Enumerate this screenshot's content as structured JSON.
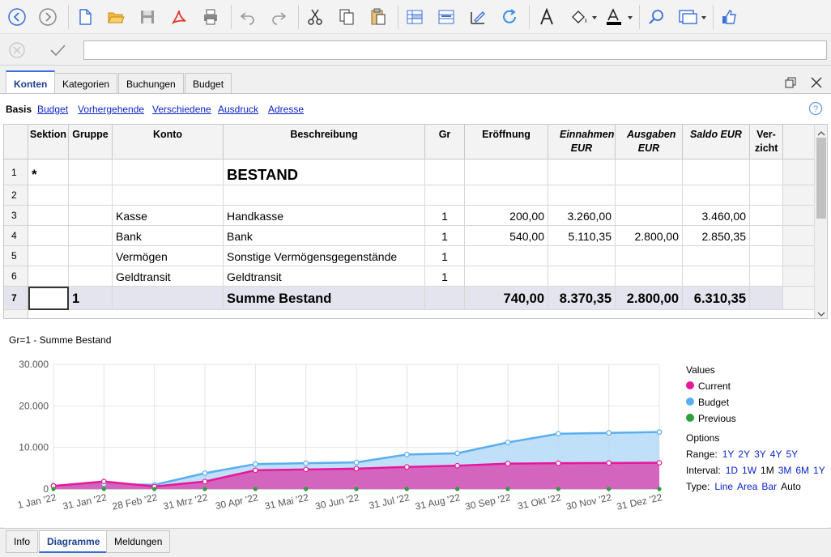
{
  "toolbar": {
    "icons": [
      "back-icon",
      "forward-icon",
      "new-file-icon",
      "open-folder-icon",
      "save-icon",
      "pdf-icon",
      "print-icon",
      "undo-icon",
      "redo-icon",
      "cut-icon",
      "copy-icon",
      "paste-icon",
      "add-row-icon",
      "insert-row-icon",
      "edit-icon",
      "refresh-icon",
      "font-icon",
      "fill-color-icon",
      "text-color-icon",
      "search-icon",
      "window-icon",
      "like-icon"
    ]
  },
  "tabs": [
    "Konten",
    "Kategorien",
    "Buchungen",
    "Budget"
  ],
  "views": {
    "active": "Basis",
    "links": [
      "Budget",
      "Vorhergehende",
      "Verschiedene",
      "Ausdruck",
      "Adresse"
    ]
  },
  "columns": [
    "Sektion",
    "Gruppe",
    "Konto",
    "Beschreibung",
    "Gr",
    "Eröffnung",
    "Einnahmen EUR",
    "Ausgaben EUR",
    "Saldo EUR",
    "Ver-zicht"
  ],
  "rows": [
    {
      "n": "1",
      "sektion": "*",
      "gruppe": "",
      "konto": "",
      "beschreibung": "BESTAND",
      "gr": "",
      "eroeffnung": "",
      "einnahmen": "",
      "ausgaben": "",
      "saldo": ""
    },
    {
      "n": "2",
      "sektion": "",
      "gruppe": "",
      "konto": "",
      "beschreibung": "",
      "gr": "",
      "eroeffnung": "",
      "einnahmen": "",
      "ausgaben": "",
      "saldo": ""
    },
    {
      "n": "3",
      "sektion": "",
      "gruppe": "",
      "konto": "Kasse",
      "beschreibung": "Handkasse",
      "gr": "1",
      "eroeffnung": "200,00",
      "einnahmen": "3.260,00",
      "ausgaben": "",
      "saldo": "3.460,00"
    },
    {
      "n": "4",
      "sektion": "",
      "gruppe": "",
      "konto": "Bank",
      "beschreibung": "Bank",
      "gr": "1",
      "eroeffnung": "540,00",
      "einnahmen": "5.110,35",
      "ausgaben": "2.800,00",
      "saldo": "2.850,35"
    },
    {
      "n": "5",
      "sektion": "",
      "gruppe": "",
      "konto": "Vermögen",
      "beschreibung": "Sonstige Vermögensgegenstände",
      "gr": "1",
      "eroeffnung": "",
      "einnahmen": "",
      "ausgaben": "",
      "saldo": ""
    },
    {
      "n": "6",
      "sektion": "",
      "gruppe": "",
      "konto": "Geldtransit",
      "beschreibung": "Geldtransit",
      "gr": "1",
      "eroeffnung": "",
      "einnahmen": "",
      "ausgaben": "",
      "saldo": ""
    },
    {
      "n": "7",
      "sektion": "",
      "gruppe": "1",
      "konto": "",
      "beschreibung": "Summe Bestand",
      "gr": "",
      "eroeffnung": "740,00",
      "einnahmen": "8.370,35",
      "ausgaben": "2.800,00",
      "saldo": "6.310,35"
    }
  ],
  "chart_title": "Gr=1 - Summe Bestand",
  "chart_data": {
    "type": "area",
    "title": "Gr=1 - Summe Bestand",
    "x": [
      "1 Jan '22",
      "31 Jan '22",
      "28 Feb '22",
      "31 Mrz '22",
      "30 Apr '22",
      "31 Mai '22",
      "30 Jun '22",
      "31 Jul '22",
      "31 Aug '22",
      "30 Sep '22",
      "31 Okt '22",
      "30 Nov '22",
      "31 Dez '22"
    ],
    "ylim": [
      0,
      30000
    ],
    "yticks": [
      "30.000",
      "20.000",
      "10.000",
      "0"
    ],
    "ytick_values": [
      30000,
      20000,
      10000,
      0
    ],
    "series": [
      {
        "name": "Budget",
        "color": "#5aaef0",
        "values": [
          800,
          1200,
          1000,
          3800,
          6000,
          6200,
          6400,
          8300,
          8600,
          11200,
          13300,
          13500,
          13700
        ]
      },
      {
        "name": "Current",
        "color": "#e8179a",
        "values": [
          740,
          1800,
          600,
          1800,
          4500,
          4700,
          4900,
          5300,
          5600,
          6100,
          6200,
          6250,
          6310
        ]
      },
      {
        "name": "Previous",
        "color": "#2e9e3e",
        "values": [
          0,
          0,
          0,
          0,
          0,
          0,
          0,
          0,
          0,
          0,
          0,
          0,
          0
        ]
      }
    ],
    "grid": true,
    "legend_position": "right"
  },
  "legend": {
    "values_title": "Values",
    "series": [
      {
        "name": "Current",
        "color": "#e8179a"
      },
      {
        "name": "Budget",
        "color": "#5aaef0"
      },
      {
        "name": "Previous",
        "color": "#2e9e3e"
      }
    ]
  },
  "options": {
    "title": "Options",
    "range_label": "Range:",
    "range_items": [
      "1Y",
      "2Y",
      "3Y",
      "4Y",
      "5Y"
    ],
    "interval_label": "Interval:",
    "interval_items": [
      "1D",
      "1W",
      "1M",
      "3M",
      "6M",
      "1Y"
    ],
    "interval_active": "1M",
    "type_label": "Type:",
    "type_items": [
      "Line",
      "Area",
      "Bar",
      "Auto"
    ],
    "type_active": "Auto"
  },
  "bottom_tabs": [
    "Info",
    "Diagramme",
    "Meldungen"
  ]
}
